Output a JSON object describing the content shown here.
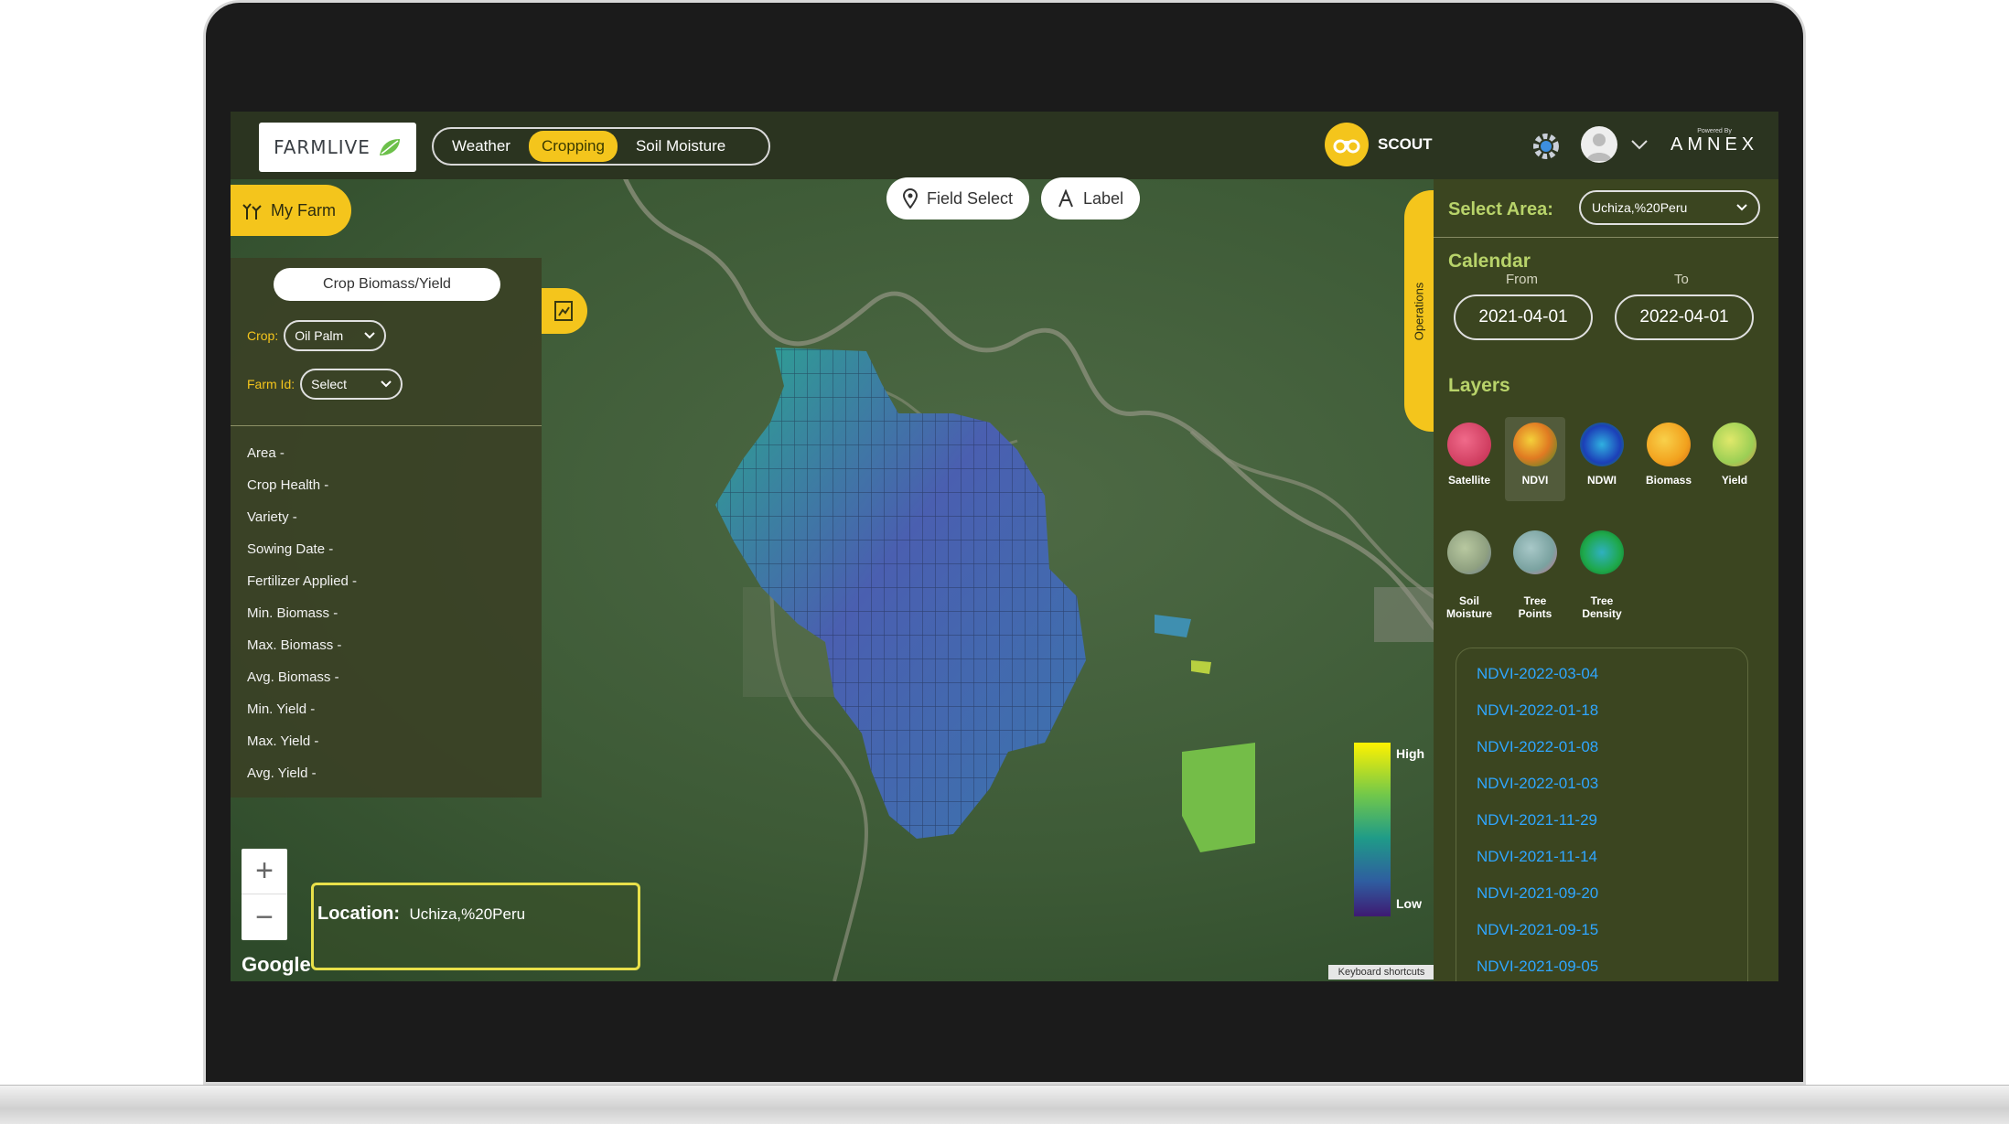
{
  "header": {
    "logo_text": "FARMLIVE",
    "nav": [
      {
        "label": "Weather",
        "active": false
      },
      {
        "label": "Cropping",
        "active": true
      },
      {
        "label": "Soil Moisture",
        "active": false
      }
    ],
    "scout_label": "SCOUT",
    "powered_by": "Powered By",
    "brand": "AMNEX"
  },
  "left_panel": {
    "my_farm_label": "My Farm",
    "crop_button": "Crop Biomass/Yield",
    "crop_label": "Crop:",
    "crop_value": "Oil Palm",
    "farm_id_label": "Farm Id:",
    "farm_id_value": "Select",
    "info": [
      "Area -",
      "Crop Health -",
      "Variety -",
      "Sowing Date -",
      "Fertilizer Applied -",
      "Min. Biomass -",
      "Max. Biomass -",
      "Avg. Biomass -",
      "Min. Yield -",
      "Max. Yield -",
      "Avg. Yield -"
    ]
  },
  "map": {
    "field_select": "Field Select",
    "label_button": "Label",
    "zoom_in": "+",
    "zoom_out": "−",
    "google": "Google",
    "location_label": "Location:",
    "location_value": "Uchiza,%20Peru",
    "keyboard_shortcuts": "Keyboard shortcuts",
    "legend_high": "High",
    "legend_low": "Low"
  },
  "right_panel": {
    "operations_tab": "Operations",
    "select_area_label": "Select Area:",
    "select_area_value": "Uchiza,%20Peru",
    "calendar_title": "Calendar",
    "from_label": "From",
    "to_label": "To",
    "from_date": "2021-04-01",
    "to_date": "2022-04-01",
    "layers_title": "Layers",
    "layers": [
      {
        "label": "Satellite",
        "color": "#d63b5e"
      },
      {
        "label": "NDVI",
        "color": "#e07a22",
        "active": true
      },
      {
        "label": "NDWI",
        "color": "#2a5fd6"
      },
      {
        "label": "Biomass",
        "color": "#f2a21e"
      },
      {
        "label": "Yield",
        "color": "#9ccf55"
      },
      {
        "label": "Soil\nMoisture",
        "color": "#8fa080"
      },
      {
        "label": "Tree\nPoints",
        "color": "#7aa2a0"
      },
      {
        "label": "Tree\nDensity",
        "color": "#1ea84a"
      }
    ],
    "ndvi_dates": [
      "NDVI-2022-03-04",
      "NDVI-2022-01-18",
      "NDVI-2022-01-08",
      "NDVI-2022-01-03",
      "NDVI-2021-11-29",
      "NDVI-2021-11-14",
      "NDVI-2021-09-20",
      "NDVI-2021-09-15",
      "NDVI-2021-09-05"
    ]
  }
}
